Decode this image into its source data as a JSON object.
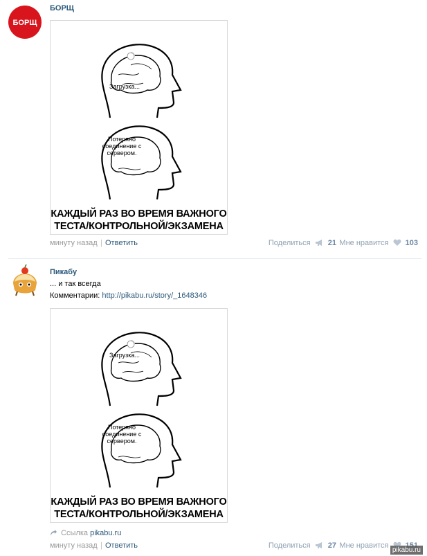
{
  "posts": [
    {
      "author": "БОРЩ",
      "avatar_text": "БОРЩ",
      "meme": {
        "top_bubble": "Загрузка...",
        "bottom_bubble": "Потеряно соединение с сервером.",
        "caption_line1": "КАЖДЫЙ РАЗ ВО ВРЕМЯ ВАЖНОГО",
        "caption_line2": "ТЕСТА/КОНТРОЛЬНОЙ/ЭКЗАМЕНА"
      },
      "footer": {
        "time": "минуту назад",
        "separator": "|",
        "reply": "Ответить",
        "share_label": "Поделиться",
        "share_count": "21",
        "like_label": "Мне нравится",
        "like_count": "103"
      }
    },
    {
      "author": "Пикабу",
      "text_line1": "... и так всегда",
      "comments_label": "Комментарии:",
      "comments_link": "http://pikabu.ru/story/_1648346",
      "meme": {
        "top_bubble": "Загрузка...",
        "bottom_bubble": "Потеряно соединение с сервером.",
        "caption_line1": "КАЖДЫЙ РАЗ ВО ВРЕМЯ ВАЖНОГО",
        "caption_line2": "ТЕСТА/КОНТРОЛЬНОЙ/ЭКЗАМЕНА"
      },
      "link_label": "Ссылка",
      "link_domain": "pikabu.ru",
      "footer": {
        "time": "минуту назад",
        "separator": "|",
        "reply": "Ответить",
        "share_label": "Поделиться",
        "share_count": "27",
        "like_label": "Мне нравится",
        "like_count": "151"
      }
    }
  ],
  "watermark": "pikabu.ru",
  "colors": {
    "link": "#2b587a",
    "muted": "#999999",
    "counter": "#6a87a5",
    "avatar_red": "#d8141c"
  }
}
